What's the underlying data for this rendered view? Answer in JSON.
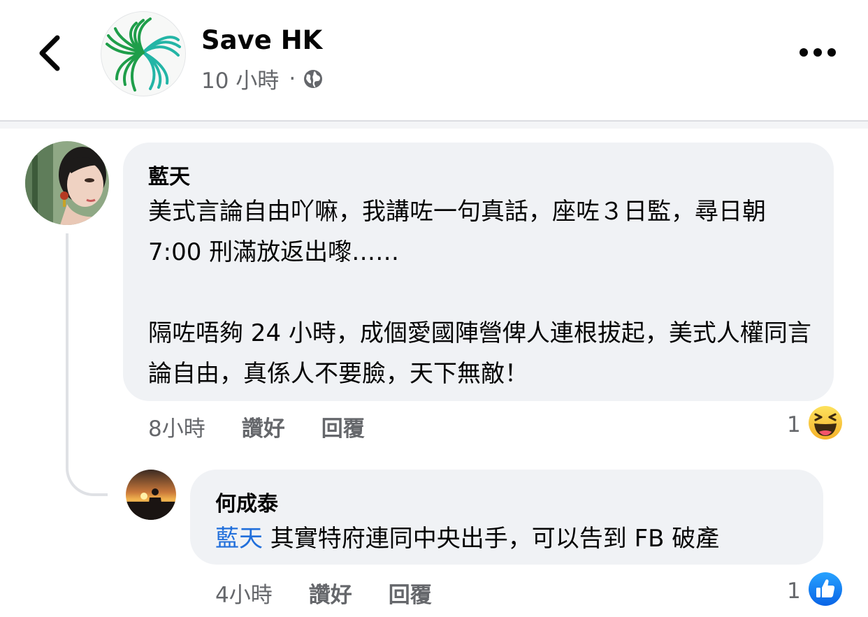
{
  "post": {
    "page_name": "Save HK",
    "time": "10 小時",
    "separator": "·",
    "privacy_icon": "globe-icon"
  },
  "comments": [
    {
      "author": "藍天",
      "text": "美式言論自由吖嘛，我講咗一句真話，座咗３日監，尋日朝 7:00 刑滿放返出嚟……\n\n隔咗唔夠 24 小時，成個愛國陣營俾人連根拔起，美式人權同言論自由，真係人不要臉，天下無敵！",
      "time": "8小時",
      "like_label": "讚好",
      "reply_label": "回覆",
      "reaction_count": "1",
      "reaction_icon": "haha-emoji-icon"
    },
    {
      "author": "何成泰",
      "mention": "藍天",
      "text": " 其實特府連同中央出手，可以告到 FB 破產",
      "time": "4小時",
      "like_label": "讚好",
      "reply_label": "回覆",
      "reaction_count": "1",
      "reaction_icon": "like-thumb-icon"
    }
  ],
  "colors": {
    "bubble": "#f0f2f5",
    "mention": "#216fdb",
    "like_blue": "#1b74e4",
    "secondary_text": "#65676b"
  }
}
